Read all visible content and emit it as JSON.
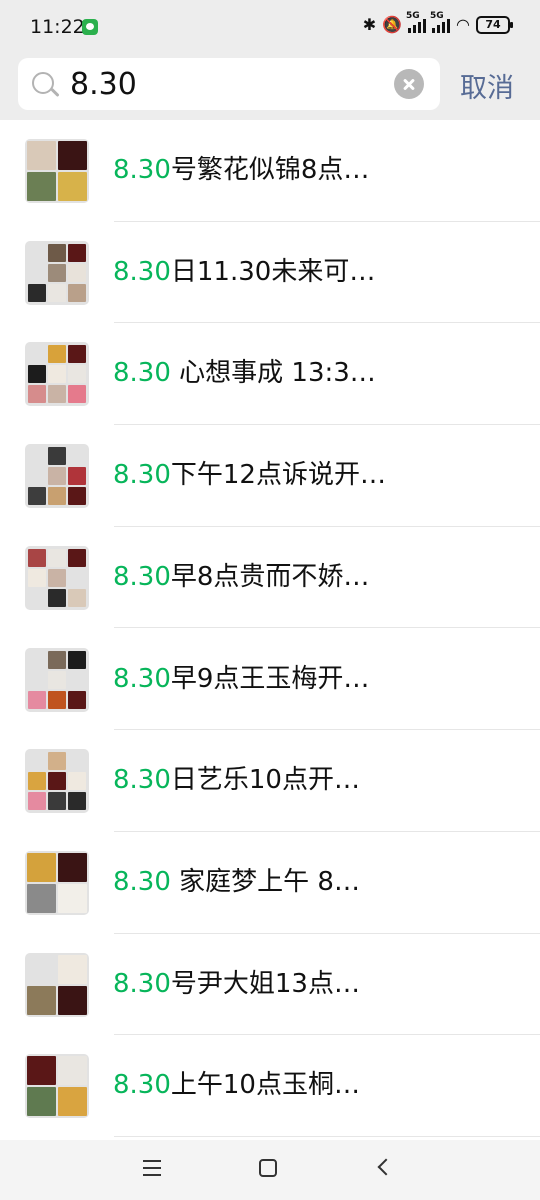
{
  "status": {
    "time": "11:22",
    "network": "5G",
    "battery": "74"
  },
  "search": {
    "value": "8.30",
    "cancel_label": "取消"
  },
  "results": [
    {
      "highlight": "8.30",
      "rest": "号繁花似锦8点…"
    },
    {
      "highlight": "8.30",
      "rest": "日11.30未来可…"
    },
    {
      "highlight": "8.30",
      "rest": " 心想事成 13:3…"
    },
    {
      "highlight": "8.30",
      "rest": "下午12点诉说开…"
    },
    {
      "highlight": "8.30",
      "rest": "早8点贵而不娇…"
    },
    {
      "highlight": "8.30",
      "rest": "早9点王玉梅开…"
    },
    {
      "highlight": "8.30",
      "rest": "日艺乐10点开…"
    },
    {
      "highlight": "8.30",
      "rest": " 家庭梦上午 8…"
    },
    {
      "highlight": "8.30",
      "rest": "号尹大姐13点…"
    },
    {
      "highlight": "8.30",
      "rest": "上午10点玉桐…"
    }
  ],
  "colors": {
    "highlight": "#07b55a",
    "cancel": "#576b95"
  }
}
